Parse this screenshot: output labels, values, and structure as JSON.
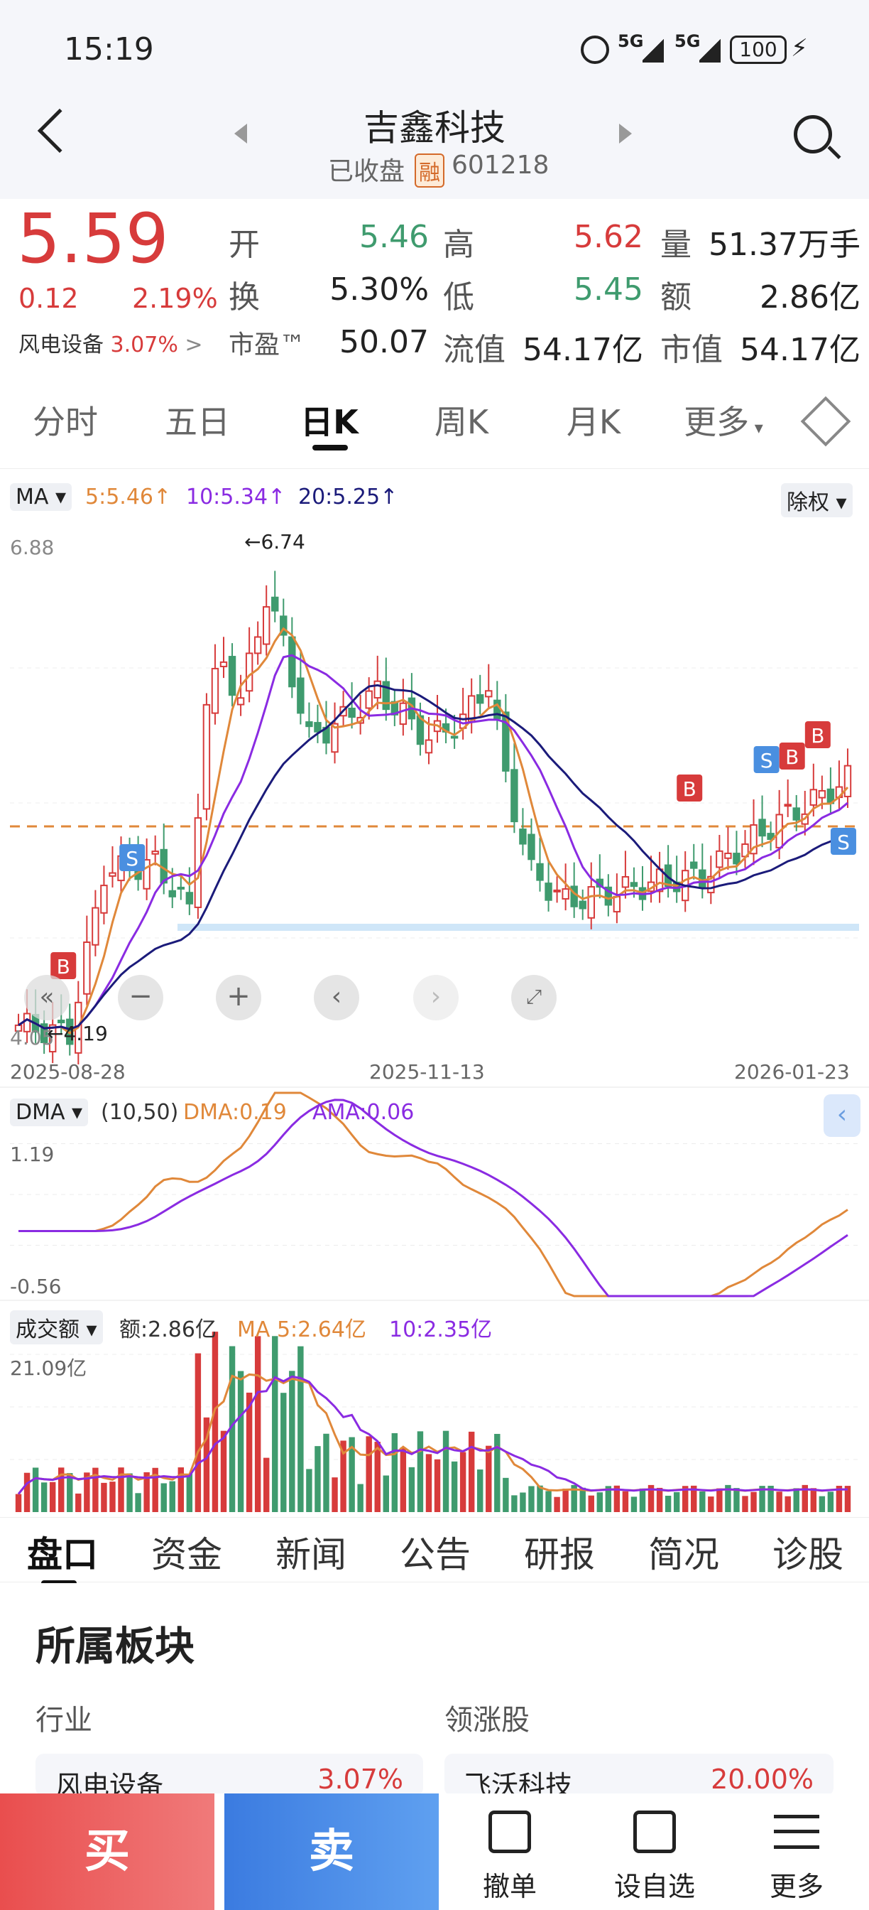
{
  "status": {
    "time": "15:19",
    "signal1": "5G",
    "signal2": "5G",
    "battery": "100"
  },
  "header": {
    "name": "吉鑫科技",
    "state": "已收盘",
    "badge": "融",
    "code": "601218"
  },
  "quote": {
    "price": "5.59",
    "change": "0.12",
    "pct": "2.19%",
    "sector": "风电设备",
    "sector_pct": "3.07%",
    "r1": [
      {
        "l": "开",
        "v": "5.46",
        "c": "green"
      },
      {
        "l": "高",
        "v": "5.62",
        "c": "red"
      },
      {
        "l": "量",
        "v": "51.37万手",
        "c": "black"
      }
    ],
    "r2": [
      {
        "l": "换",
        "v": "5.30%",
        "c": "black"
      },
      {
        "l": "低",
        "v": "5.45",
        "c": "green"
      },
      {
        "l": "额",
        "v": "2.86亿",
        "c": "black"
      }
    ],
    "r3": [
      {
        "l": "市盈™",
        "v": "50.07",
        "c": "black"
      },
      {
        "l": "流值",
        "v": "54.17亿",
        "c": "black"
      },
      {
        "l": "市值",
        "v": "54.17亿",
        "c": "black"
      }
    ]
  },
  "tabs": [
    "分时",
    "五日",
    "日K",
    "周K",
    "月K",
    "更多"
  ],
  "ma": {
    "label": "MA",
    "ma5": "5:5.46↑",
    "ma10": "10:5.34↑",
    "ma20": "20:5.25↑",
    "adjust": "除权",
    "max": "6.88",
    "min": "4.05",
    "high_mark": "←6.74",
    "low_mark": "←4.19",
    "dates": [
      "2025-08-28",
      "2025-11-13",
      "2026-01-23"
    ]
  },
  "dma": {
    "label": "DMA",
    "params": "(10,50)",
    "dma": "DMA:0.19",
    "ama": "AMA:0.06",
    "max": "1.19",
    "min": "-0.56"
  },
  "vol": {
    "label": "成交额",
    "amount": "额:2.86亿",
    "ma5": "MA 5:2.64亿",
    "ma10": "10:2.35亿",
    "max": "21.09亿"
  },
  "bottomtabs": [
    "盘口",
    "资金",
    "新闻",
    "公告",
    "研报",
    "简况",
    "诊股"
  ],
  "section": {
    "title": "所属板块",
    "col1": "行业",
    "col2": "领涨股",
    "item1": "风电设备",
    "item1_pct": "3.07%",
    "item2": "飞沃科技",
    "item2_pct": "20.00%"
  },
  "actions": {
    "buy": "买",
    "sell": "卖",
    "cancel": "撤单",
    "watch": "设自选",
    "more": "更多"
  },
  "colors": {
    "up": "#d73b3b",
    "down": "#3f9b6e",
    "ma5": "#e0883a",
    "ma10": "#8a2be2",
    "ma20": "#1b1b7a"
  }
}
